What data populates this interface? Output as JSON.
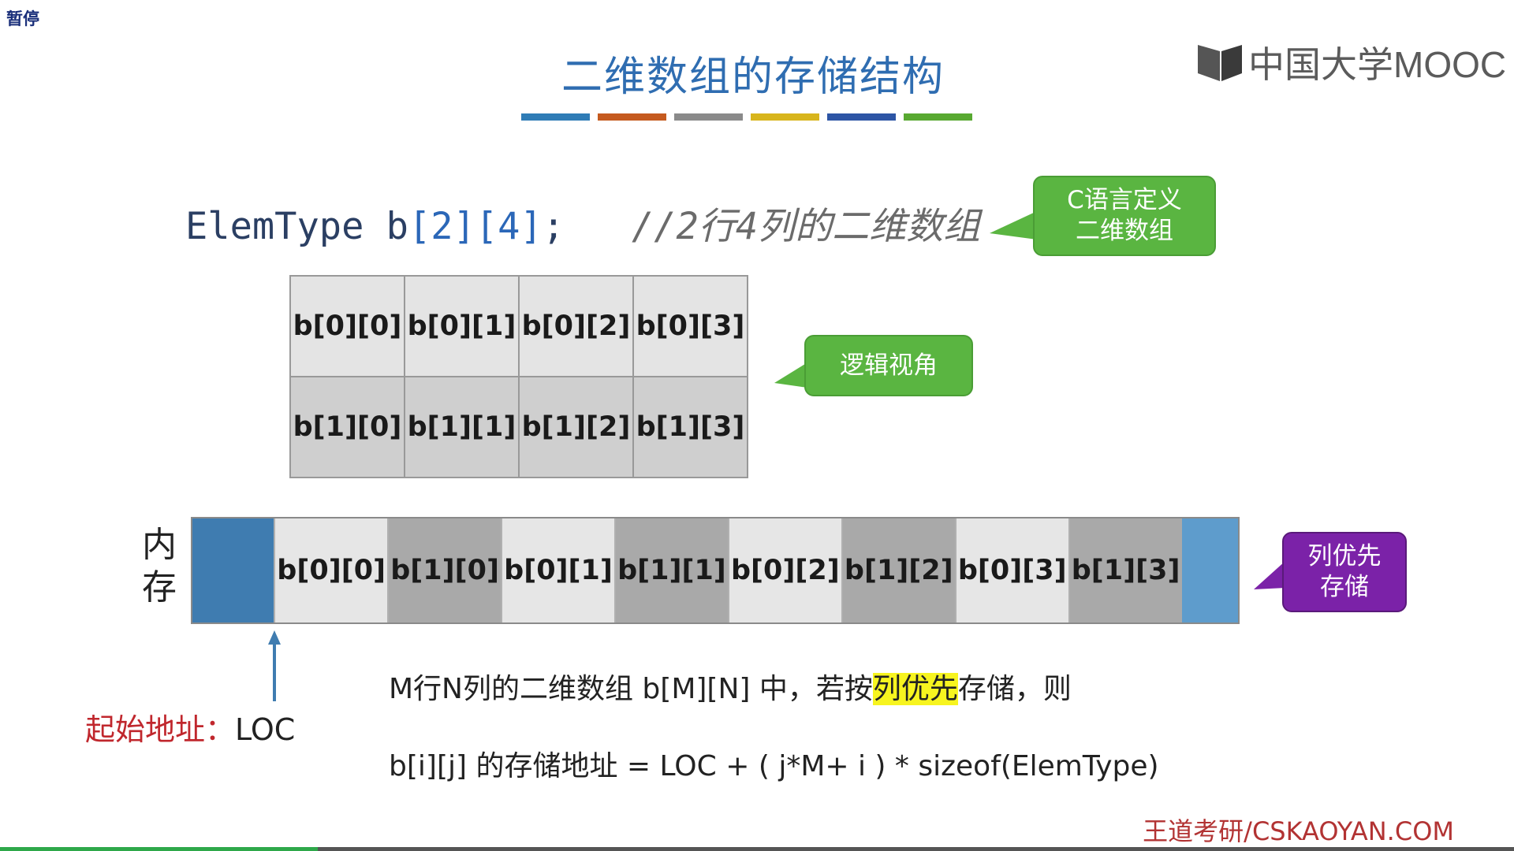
{
  "player": {
    "pause_label": "暂停",
    "progress_fraction": 0.21
  },
  "slide": {
    "title": "二维数组的存储结构",
    "color_bar": [
      "#2f7cb6",
      "#c55a1f",
      "#8a8a8a",
      "#d8b51c",
      "#2d55a5",
      "#58a931"
    ],
    "logo": {
      "text": "中国大学MOOC",
      "icon": "book-icon"
    },
    "code": {
      "type": "ElemType",
      "var": "b",
      "dim1": "2",
      "dim2": "4",
      "comment": "//2行4列的二维数组"
    },
    "callouts": {
      "c_definition": "C语言定义\n二维数组",
      "logical_view": "逻辑视角",
      "column_major": "列优先\n存储"
    },
    "matrix": [
      [
        "b[0][0]",
        "b[0][1]",
        "b[0][2]",
        "b[0][3]"
      ],
      [
        "b[1][0]",
        "b[1][1]",
        "b[1][2]",
        "b[1][3]"
      ]
    ],
    "memory": {
      "label": "内\n存",
      "cells": [
        "b[0][0]",
        "b[1][0]",
        "b[0][1]",
        "b[1][1]",
        "b[0][2]",
        "b[1][2]",
        "b[0][3]",
        "b[1][3]"
      ]
    },
    "start_address": {
      "label": "起始地址：",
      "value": "LOC"
    },
    "explanation": {
      "line1_pre": "M行N列的二维数组 b[M][N] 中，若按",
      "line1_highlight": "列优先",
      "line1_post": "存储，则",
      "line2": "b[i][j] 的存储地址 = LOC + ( j*M+ i ) * sizeof(ElemType)"
    },
    "footer": "王道考研/CSKAOYAN.COM"
  }
}
